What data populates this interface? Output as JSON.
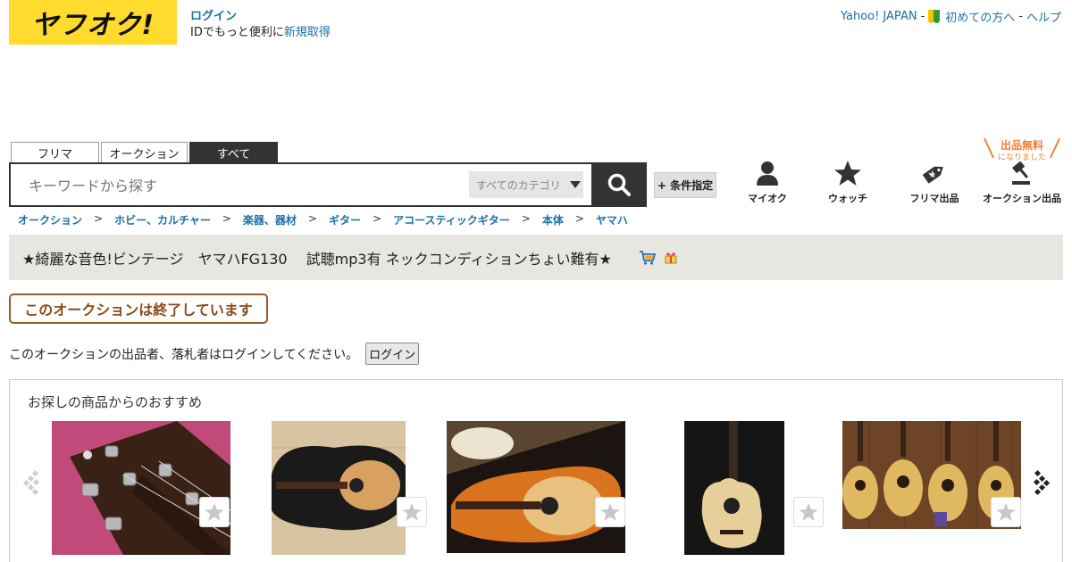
{
  "header": {
    "logo_text": "ヤフオク!",
    "login_link": "ログイン",
    "signup_prefix": "IDでもっと便利に",
    "signup_link": "新規取得",
    "nav": {
      "yahoo": "Yahoo! JAPAN",
      "beginner": "初めての方へ",
      "help": "ヘルプ"
    }
  },
  "search": {
    "tabs": [
      "フリマ",
      "オークション",
      "すべて"
    ],
    "active_tab": "すべて",
    "placeholder": "キーワードから探す",
    "category": "すべてのカテゴリ",
    "condition_button": "+ 条件指定"
  },
  "icon_nav": [
    {
      "label": "マイオク",
      "icon": "user-icon"
    },
    {
      "label": "ウォッチ",
      "icon": "star-icon"
    },
    {
      "label": "フリマ出品",
      "icon": "tag-icon"
    },
    {
      "label": "オークション出品",
      "icon": "gavel-icon"
    }
  ],
  "free_badge": {
    "main": "出品無料",
    "sub": "になりました"
  },
  "breadcrumb": [
    "オークション",
    "ホビー、カルチャー",
    "楽器、器材",
    "ギター",
    "アコースティックギター",
    "本体",
    "ヤマハ"
  ],
  "title": "★綺麗な音色!ビンテージ　ヤマハFG130　 試聴mp3有 ネックコンディションちょい難有★",
  "ended_label": "このオークションは終了しています",
  "notice": {
    "text": "このオークションの出品者、落札者はログインしてください。",
    "button": "ログイン"
  },
  "recommend": {
    "heading": "お探しの商品からのおすすめ"
  },
  "colors": {
    "brand_yellow": "#ffdb2e",
    "link_blue": "#1a6fa8",
    "ended_brown": "#8b4a1a",
    "free_orange": "#e8833a"
  }
}
